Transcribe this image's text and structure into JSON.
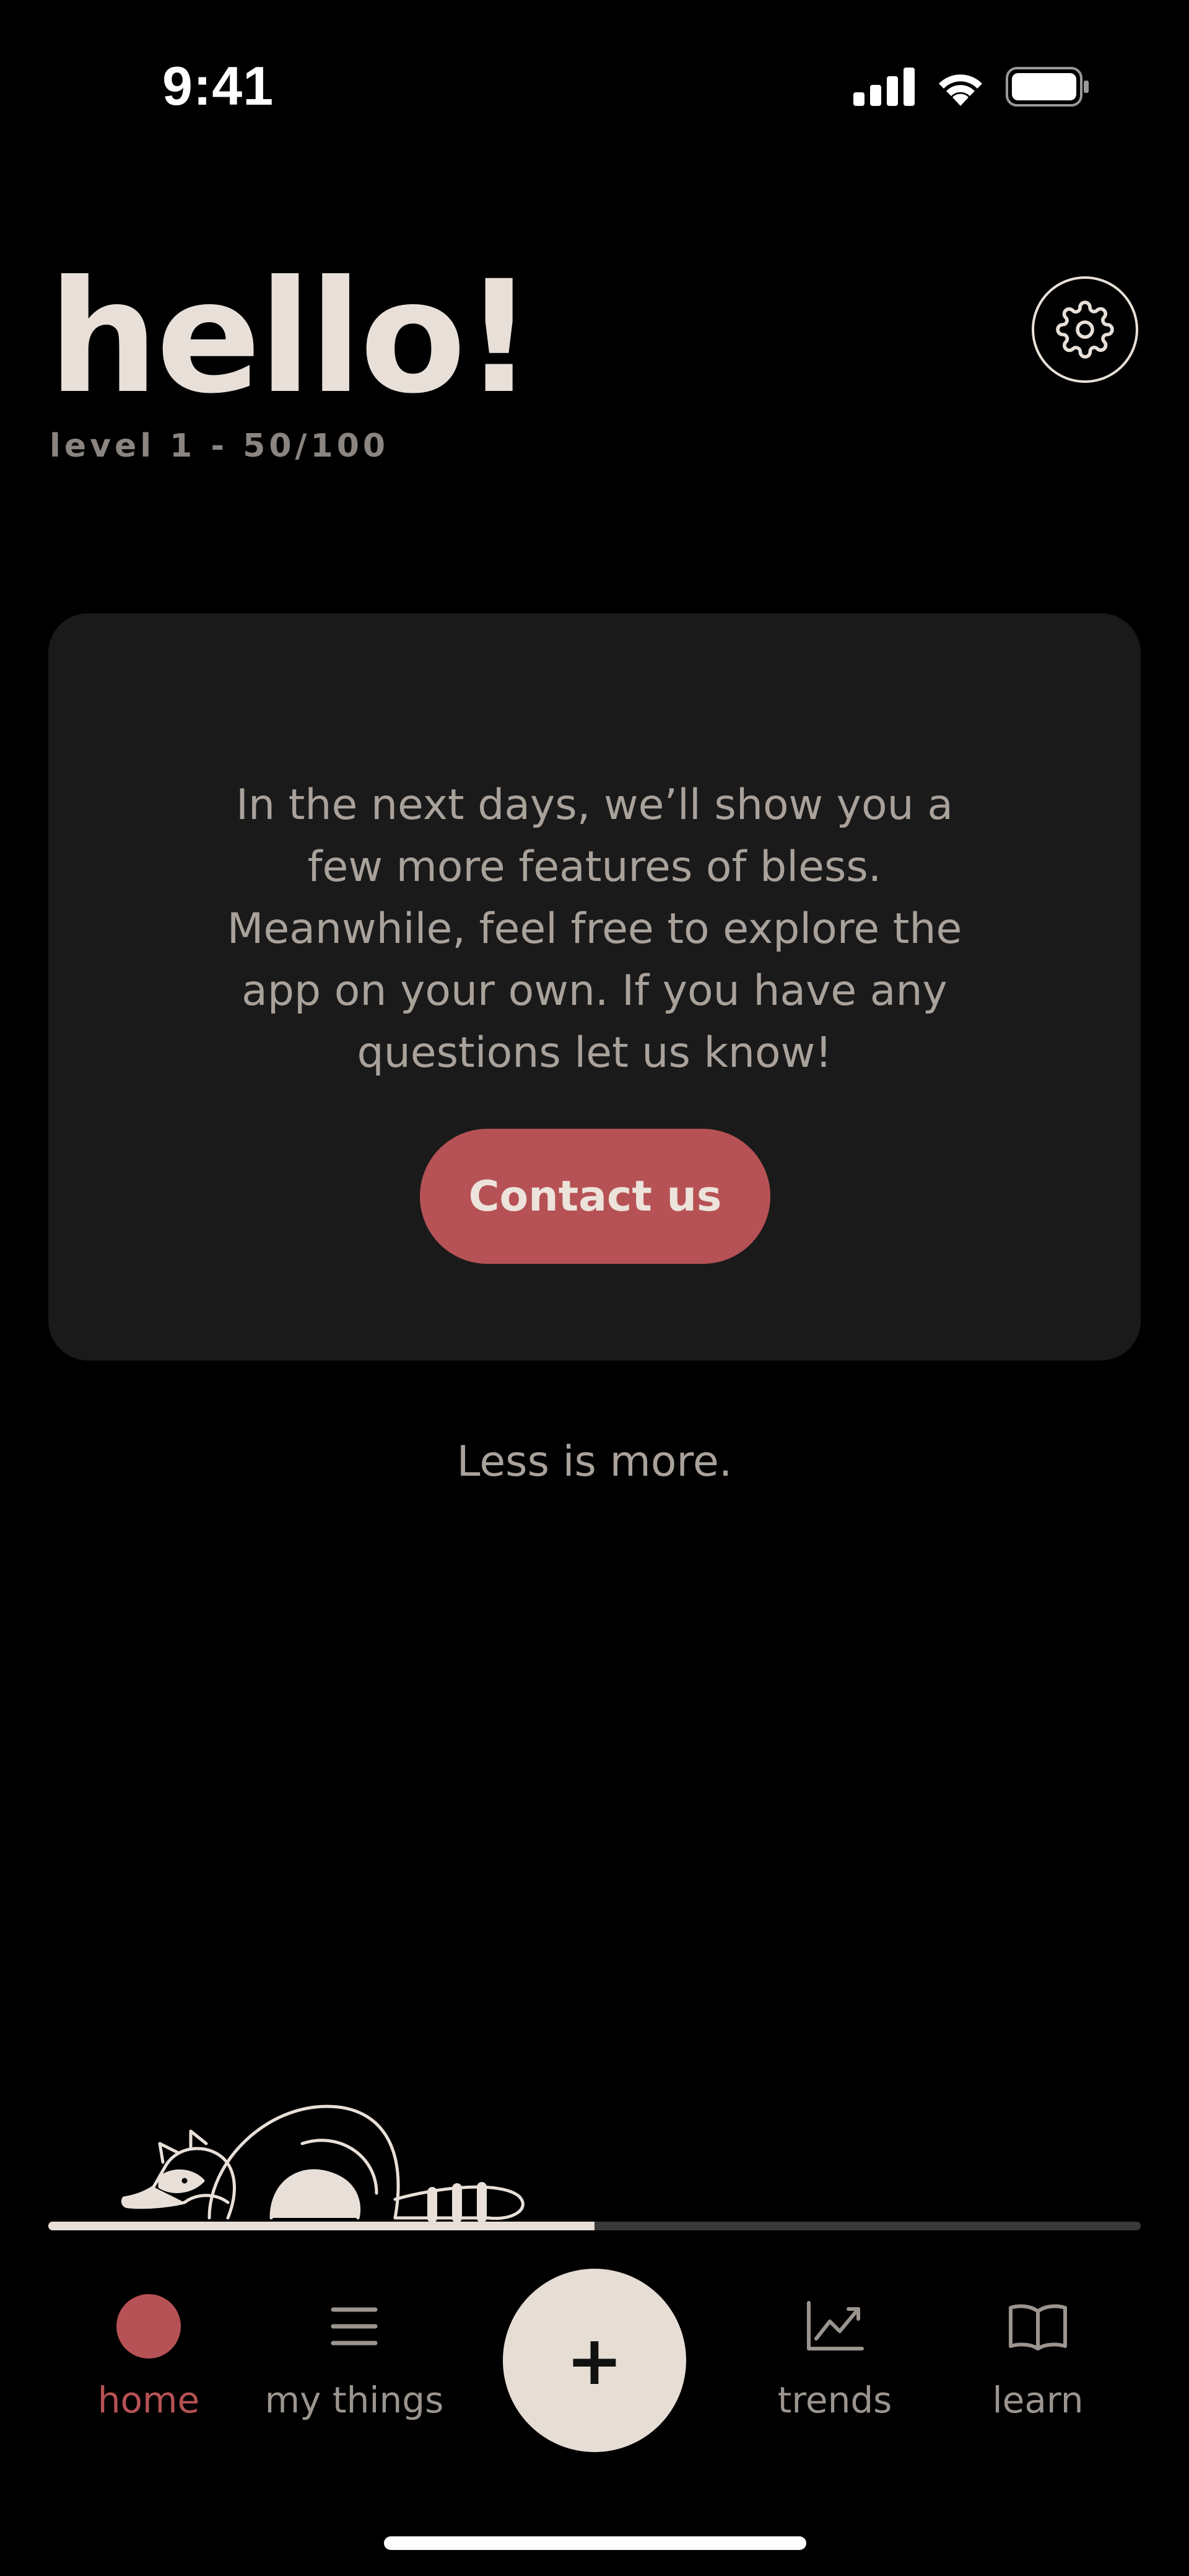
{
  "status_bar": {
    "time": "9:41"
  },
  "header": {
    "greeting": "hello!",
    "level": "level 1 - 50/100"
  },
  "card": {
    "message": "In the next days, we’ll show you a few more features of bless. Meanwhile, feel free to explore the app on your own. If you have any questions let us know!",
    "contact_label": "Contact us"
  },
  "motto": "Less is more.",
  "progress": {
    "fraction": 0.5
  },
  "tabs": [
    {
      "label": "home",
      "icon": "home-dot-icon",
      "active": true
    },
    {
      "label": "my things",
      "icon": "list-icon",
      "active": false
    },
    {
      "label": "trends",
      "icon": "chart-icon",
      "active": false
    },
    {
      "label": "learn",
      "icon": "book-icon",
      "active": false
    }
  ],
  "add_button": {
    "label": "+"
  },
  "colors": {
    "accent": "#b65255",
    "cream": "#e8e0d8",
    "card_bg": "#1b1a1a",
    "muted_text": "#a9a29b"
  }
}
